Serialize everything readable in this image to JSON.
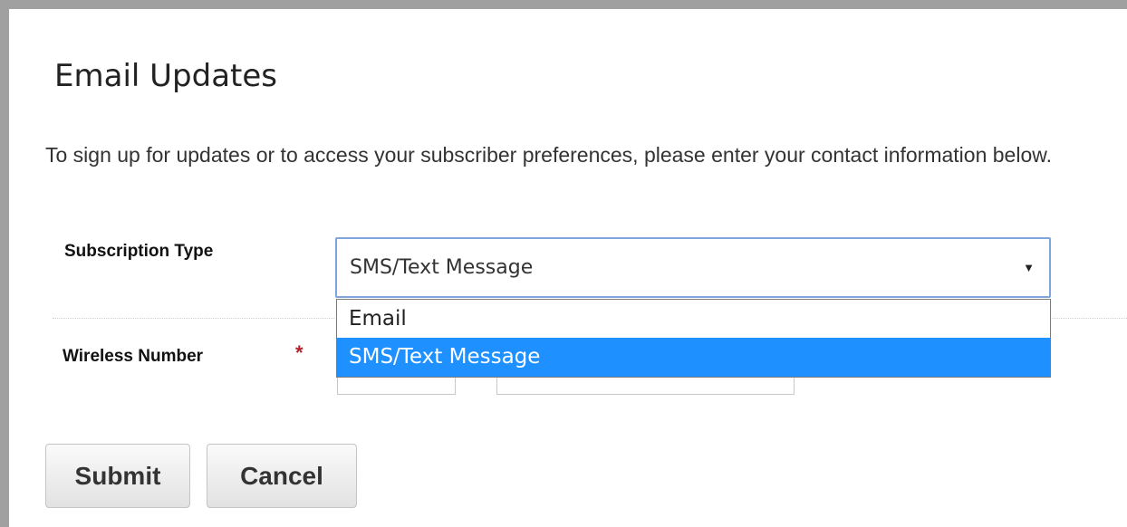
{
  "page": {
    "title": "Email Updates",
    "intro": "To sign up for updates or to access your subscriber preferences, please enter your contact information below."
  },
  "form": {
    "subscription_type": {
      "label": "Subscription Type",
      "selected": "SMS/Text Message",
      "options": [
        "Email",
        "SMS/Text Message"
      ],
      "highlighted_option": "SMS/Text Message"
    },
    "wireless_number": {
      "label": "Wireless Number",
      "required_marker": "*"
    }
  },
  "buttons": {
    "submit_label": "Submit",
    "cancel_label": "Cancel"
  },
  "colors": {
    "highlight": "#1e90ff",
    "required": "#b3222a",
    "focus_border": "#7ea5dc"
  },
  "icons": {
    "dropdown": "caret-down-icon"
  }
}
